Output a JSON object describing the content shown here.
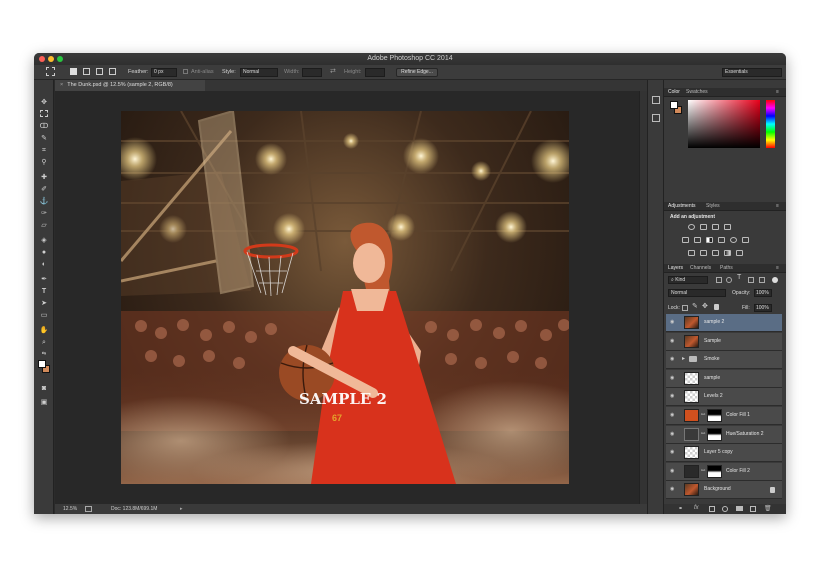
{
  "window": {
    "title": "Adobe Photoshop CC 2014"
  },
  "options": {
    "feather_label": "Feather:",
    "feather_value": "0 px",
    "antialias_label": "Anti-alias",
    "style_label": "Style:",
    "style_value": "Normal",
    "width_label": "Width:",
    "height_label": "Height:",
    "refine_edge": "Refine Edge...",
    "workspace": "Essentials"
  },
  "document": {
    "tab_title": "The Dunk.psd @ 12.5% (sample 2, RGB/8)",
    "watermark": "SAMPLE 2",
    "jersey_number": "67"
  },
  "status": {
    "zoom": "12.5%",
    "doc_info": "Doc: 123.8M/699.1M"
  },
  "panels": {
    "color_tab": "Color",
    "swatches_tab": "Swatches",
    "adjustments_tab": "Adjustments",
    "styles_tab": "Styles",
    "add_adjustment": "Add an adjustment",
    "layers_tab": "Layers",
    "channels_tab": "Channels",
    "paths_tab": "Paths",
    "filter_kind": "Kind",
    "blend_mode": "Normal",
    "opacity_label": "Opacity:",
    "opacity_value": "100%",
    "lock_label": "Lock:",
    "fill_label": "Fill:",
    "fill_value": "100%"
  },
  "layers": [
    {
      "name": "sample 2",
      "selected": true,
      "thumb": "photo"
    },
    {
      "name": "Sample",
      "thumb": "photo"
    },
    {
      "name": "Smoke",
      "thumb": "folder"
    },
    {
      "name": "sample",
      "thumb": "checker"
    },
    {
      "name": "Levels 2",
      "thumb": "checker"
    },
    {
      "name": "Color Fill 1",
      "thumb": "orange",
      "mask": true
    },
    {
      "name": "Hue/Saturation 2",
      "thumb": "adjust",
      "mask": true
    },
    {
      "name": "Layer 5 copy",
      "thumb": "checker"
    },
    {
      "name": "Color Fill 2",
      "thumb": "dark",
      "mask": true
    },
    {
      "name": "Background",
      "thumb": "photo"
    }
  ],
  "colors": {
    "accent_selection": "#5a6d85",
    "foreground": "#ffffff",
    "background": "#d28a5a"
  }
}
